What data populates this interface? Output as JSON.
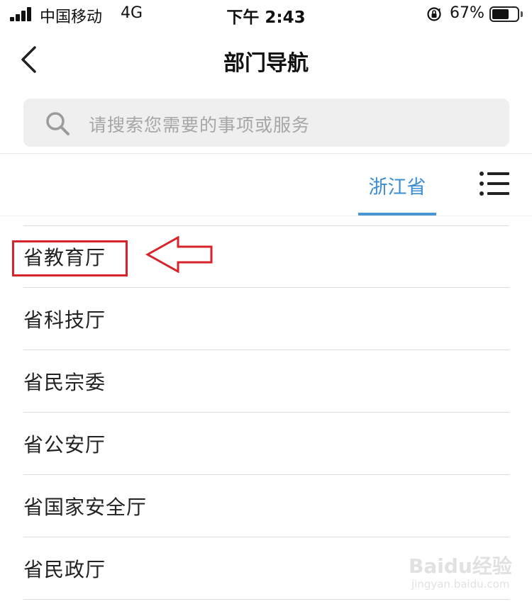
{
  "status_bar": {
    "carrier": "中国移动",
    "network": "4G",
    "time": "下午 2:43",
    "battery_percent": "67%",
    "battery_level": 0.67,
    "icons": [
      "signal-icon",
      "rotation-lock-icon",
      "battery-icon"
    ]
  },
  "nav": {
    "title": "部门导航",
    "back_icon": "chevron-left-icon"
  },
  "search": {
    "placeholder": "请搜索您需要的事项或服务",
    "icon": "search-icon"
  },
  "tabs": {
    "active": "浙江省",
    "menu_icon": "list-menu-icon"
  },
  "departments": [
    {
      "label": "省教育厅"
    },
    {
      "label": "省科技厅"
    },
    {
      "label": "省民宗委"
    },
    {
      "label": "省公安厅"
    },
    {
      "label": "省国家安全厅"
    },
    {
      "label": "省民政厅"
    }
  ],
  "annotation": {
    "highlighted_item": "省教育厅",
    "color": "#d8232a"
  },
  "watermark": {
    "text": "Baidu经验",
    "url_text": "jingyan.baidu.com"
  },
  "colors": {
    "accent": "#3b8ed4",
    "annotation": "#d8232a"
  }
}
